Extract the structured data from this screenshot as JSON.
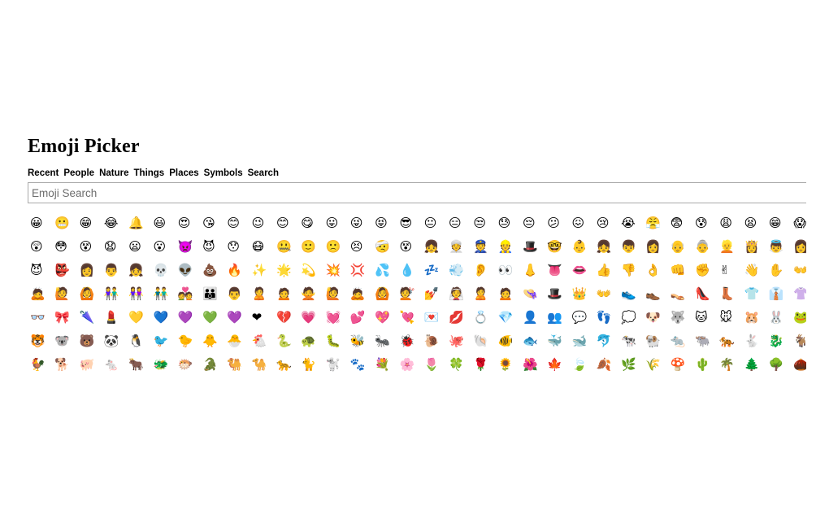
{
  "title": "Emoji Picker",
  "tabs": [
    {
      "label": "Recent"
    },
    {
      "label": "People"
    },
    {
      "label": "Nature"
    },
    {
      "label": "Things"
    },
    {
      "label": "Places"
    },
    {
      "label": "Symbols"
    },
    {
      "label": "Search"
    }
  ],
  "search": {
    "placeholder": "Emoji Search",
    "value": ""
  },
  "emoji_rows": [
    [
      "😀",
      "😬",
      "😁",
      "😂",
      "🔔",
      "😃",
      "😍",
      "😘",
      "😊",
      "😉",
      "😊",
      "😋",
      "😛",
      "😜",
      "😝",
      "😎",
      "😐",
      "😑",
      "😒",
      "😓",
      "😔",
      "😕",
      "😖",
      "😢",
      "😭",
      "😤",
      "😨",
      "😰",
      "😩",
      "😫",
      "😁",
      "😱"
    ],
    [
      "😲",
      "😳",
      "😵",
      "😧",
      "😦",
      "😮",
      "👿",
      "😈",
      "😯",
      "😷",
      "🤐",
      "🙂",
      "🙁",
      "😣",
      "🤕",
      "😵",
      "👧",
      "👳",
      "👮",
      "👷",
      "🎩",
      "🤓",
      "👶",
      "👧",
      "👦",
      "👩",
      "👴",
      "👵",
      "👱",
      "👸",
      "👼",
      "👩"
    ],
    [
      "😈",
      "👺",
      "👩",
      "👨",
      "👧",
      "💀",
      "👽",
      "💩",
      "🔥",
      "✨",
      "🌟",
      "💫",
      "💥",
      "💢",
      "💦",
      "💧",
      "💤",
      "💨",
      "👂",
      "👀",
      "👃",
      "👅",
      "👄",
      "👍",
      "👎",
      "👌",
      "👊",
      "✊",
      "✌",
      "👋",
      "✋",
      "👐"
    ],
    [
      "🙇",
      "🙋",
      "🙆",
      "👫",
      "👭",
      "👬",
      "💑",
      "👪",
      "👨",
      "🙎",
      "🙍",
      "🙅",
      "🙋",
      "🙇",
      "🙆",
      "💇",
      "💅",
      "👰",
      "🙎",
      "🙍",
      "👒",
      "🎩",
      "👑",
      "👐",
      "👟",
      "👞",
      "👡",
      "👠",
      "👢",
      "👕",
      "👔",
      "👚"
    ],
    [
      "👓",
      "🎀",
      "🌂",
      "💄",
      "💛",
      "💙",
      "💜",
      "💚",
      "💜",
      "❤",
      "💔",
      "💗",
      "💓",
      "💕",
      "💖",
      "💘",
      "💌",
      "💋",
      "💍",
      "💎",
      "👤",
      "👥",
      "💬",
      "👣",
      "💭",
      "🐶",
      "🐺",
      "🐱",
      "🐭",
      "🐹",
      "🐰",
      "🐸"
    ],
    [
      "🐯",
      "🐨",
      "🐻",
      "🐼",
      "🐧",
      "🐦",
      "🐤",
      "🐥",
      "🐣",
      "🐔",
      "🐍",
      "🐢",
      "🐛",
      "🐝",
      "🐜",
      "🐞",
      "🐌",
      "🐙",
      "🐚",
      "🐠",
      "🐟",
      "🐳",
      "🐋",
      "🐬",
      "🐄",
      "🐏",
      "🐀",
      "🐃",
      "🐅",
      "🐇",
      "🐉",
      "🐐"
    ],
    [
      "🐓",
      "🐕",
      "🐖",
      "🐁",
      "🐂",
      "🐲",
      "🐡",
      "🐊",
      "🐫",
      "🐪",
      "🐆",
      "🐈",
      "🐩",
      "🐾",
      "💐",
      "🌸",
      "🌷",
      "🍀",
      "🌹",
      "🌻",
      "🌺",
      "🍁",
      "🍃",
      "🍂",
      "🌿",
      "🌾",
      "🍄",
      "🌵",
      "🌴",
      "🌲",
      "🌳",
      "🌰"
    ]
  ]
}
